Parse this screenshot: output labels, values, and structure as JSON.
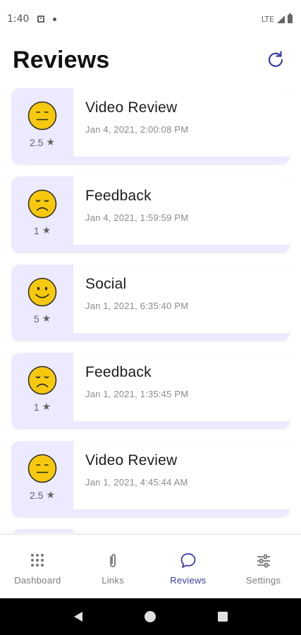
{
  "status_bar": {
    "time": "1:40",
    "network": "LTE"
  },
  "header": {
    "title": "Reviews"
  },
  "reviews": [
    {
      "title": "Video Review",
      "date": "Jan 4, 2021, 2:00:08 PM",
      "rating": "2.5",
      "mood": "neutral"
    },
    {
      "title": "Feedback",
      "date": "Jan 4, 2021, 1:59:59 PM",
      "rating": "1",
      "mood": "sad"
    },
    {
      "title": "Social",
      "date": "Jan 1, 2021, 6:35:40 PM",
      "rating": "5",
      "mood": "happy"
    },
    {
      "title": "Feedback",
      "date": "Jan 1, 2021, 1:35:45 PM",
      "rating": "1",
      "mood": "sad"
    },
    {
      "title": "Video Review",
      "date": "Jan 1, 2021, 4:45:44 AM",
      "rating": "2.5",
      "mood": "neutral"
    }
  ],
  "nav": [
    {
      "label": "Dashboard",
      "icon": "dots-grid-icon",
      "active": false
    },
    {
      "label": "Links",
      "icon": "paperclip-icon",
      "active": false
    },
    {
      "label": "Reviews",
      "icon": "chat-bubble-icon",
      "active": true
    },
    {
      "label": "Settings",
      "icon": "sliders-icon",
      "active": false
    }
  ],
  "colors": {
    "accent": "#3c3aa8",
    "card_tint": "#eceaff",
    "face": "#f6c90e"
  }
}
